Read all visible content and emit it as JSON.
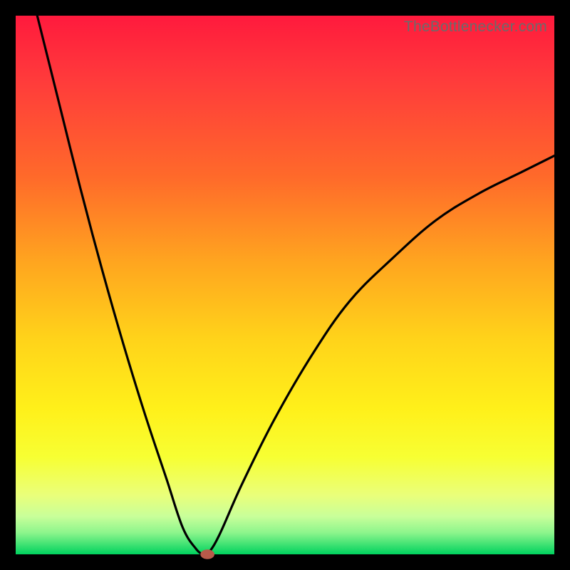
{
  "attribution": "TheBottlenecker.com",
  "chart_data": {
    "type": "line",
    "title": "",
    "xlabel": "",
    "ylabel": "",
    "xlim": [
      0,
      100
    ],
    "ylim": [
      0,
      100
    ],
    "series": [
      {
        "name": "bottleneck-curve",
        "x": [
          4,
          8,
          12,
          16,
          20,
          24,
          28,
          31,
          33.5,
          35,
          36,
          38,
          42,
          48,
          55,
          62,
          70,
          78,
          86,
          94,
          100
        ],
        "y": [
          100,
          84,
          68,
          53,
          39,
          26,
          14,
          5,
          1,
          0,
          0.5,
          4,
          13,
          25,
          37,
          47,
          55,
          62,
          67,
          71,
          74
        ]
      }
    ],
    "marker": {
      "x": 35.6,
      "y": 0,
      "rx": 1.3,
      "ry": 0.9
    }
  }
}
